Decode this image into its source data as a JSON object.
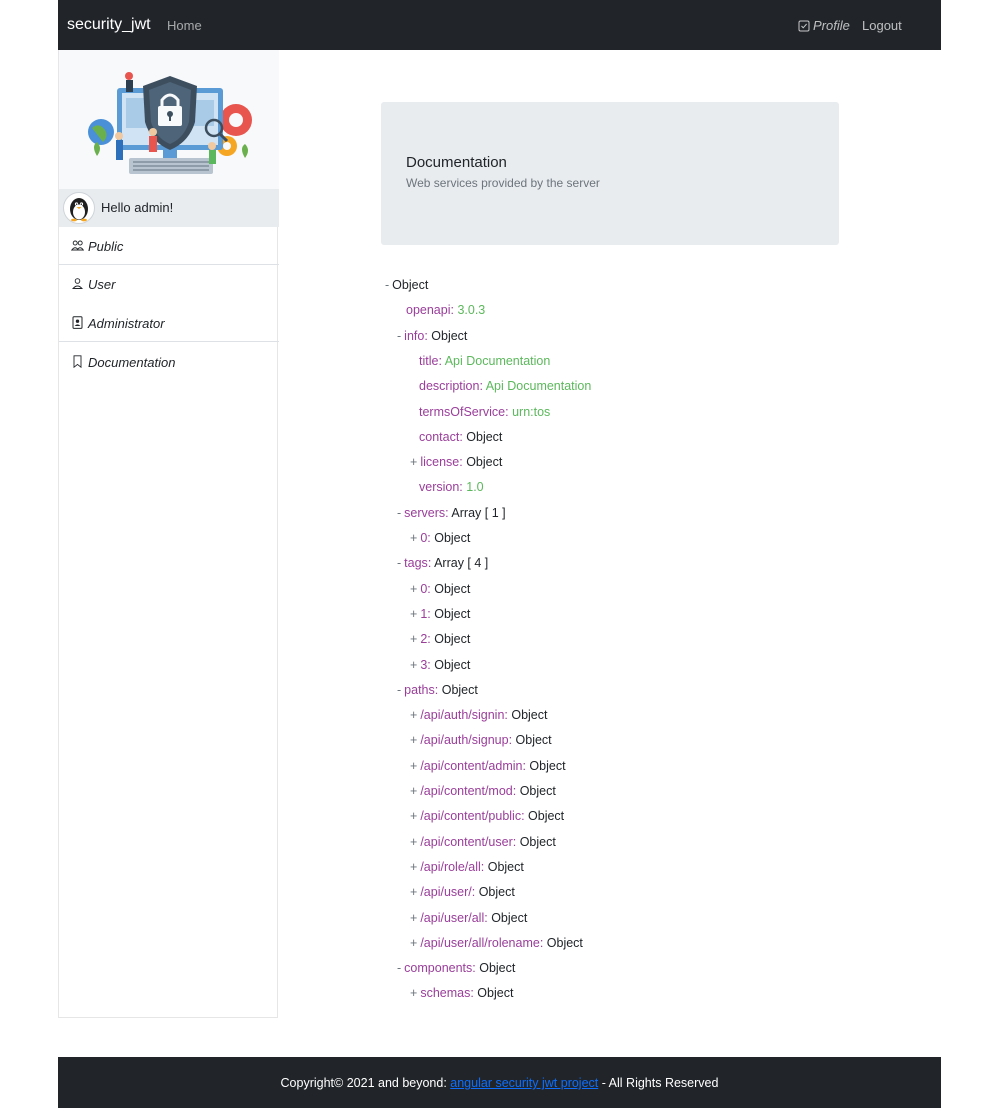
{
  "navbar": {
    "brand": "security_jwt",
    "home": "Home",
    "profile": "Profile",
    "logout": "Logout"
  },
  "sidebar": {
    "greeting": "Hello admin!",
    "items": [
      {
        "label": "Public",
        "icon": "people-icon"
      },
      {
        "label": "User",
        "icon": "person-icon"
      },
      {
        "label": "Administrator",
        "icon": "badge-icon"
      },
      {
        "label": "Documentation",
        "icon": "bookmark-icon"
      }
    ]
  },
  "jumbotron": {
    "title": "Documentation",
    "subtitle": "Web services provided by the server"
  },
  "tree": [
    {
      "toggle": "-",
      "key": "",
      "value": "Object",
      "kind": "type"
    },
    {
      "toggle": "",
      "key": "openapi",
      "value": "3.0.3",
      "kind": "val"
    },
    {
      "toggle": "-",
      "key": "info",
      "value": "Object",
      "kind": "type"
    },
    {
      "toggle": "",
      "key": "title",
      "value": "Api Documentation",
      "kind": "val"
    },
    {
      "toggle": "",
      "key": "description",
      "value": "Api Documentation",
      "kind": "val"
    },
    {
      "toggle": "",
      "key": "termsOfService",
      "value": "urn:tos",
      "kind": "val"
    },
    {
      "toggle": "",
      "key": "contact",
      "value": "Object",
      "kind": "type"
    },
    {
      "toggle": "+",
      "key": "license",
      "value": "Object",
      "kind": "type"
    },
    {
      "toggle": "",
      "key": "version",
      "value": "1.0",
      "kind": "val"
    },
    {
      "toggle": "-",
      "key": "servers",
      "value": "Array [ 1 ]",
      "kind": "type"
    },
    {
      "toggle": "+",
      "key": "0",
      "value": "Object",
      "kind": "type"
    },
    {
      "toggle": "-",
      "key": "tags",
      "value": "Array [ 4 ]",
      "kind": "type"
    },
    {
      "toggle": "+",
      "key": "0",
      "value": "Object",
      "kind": "type"
    },
    {
      "toggle": "+",
      "key": "1",
      "value": "Object",
      "kind": "type"
    },
    {
      "toggle": "+",
      "key": "2",
      "value": "Object",
      "kind": "type"
    },
    {
      "toggle": "+",
      "key": "3",
      "value": "Object",
      "kind": "type"
    },
    {
      "toggle": "-",
      "key": "paths",
      "value": "Object",
      "kind": "type"
    },
    {
      "toggle": "+",
      "key": "/api/auth/signin",
      "value": "Object",
      "kind": "type"
    },
    {
      "toggle": "+",
      "key": "/api/auth/signup",
      "value": "Object",
      "kind": "type"
    },
    {
      "toggle": "+",
      "key": "/api/content/admin",
      "value": "Object",
      "kind": "type"
    },
    {
      "toggle": "+",
      "key": "/api/content/mod",
      "value": "Object",
      "kind": "type"
    },
    {
      "toggle": "+",
      "key": "/api/content/public",
      "value": "Object",
      "kind": "type"
    },
    {
      "toggle": "+",
      "key": "/api/content/user",
      "value": "Object",
      "kind": "type"
    },
    {
      "toggle": "+",
      "key": "/api/role/all",
      "value": "Object",
      "kind": "type"
    },
    {
      "toggle": "+",
      "key": "/api/user/",
      "value": "Object",
      "kind": "type"
    },
    {
      "toggle": "+",
      "key": "/api/user/all",
      "value": "Object",
      "kind": "type"
    },
    {
      "toggle": "+",
      "key": "/api/user/all/rolename",
      "value": "Object",
      "kind": "type"
    },
    {
      "toggle": "-",
      "key": "components",
      "value": "Object",
      "kind": "type"
    },
    {
      "toggle": "+",
      "key": "schemas",
      "value": "Object",
      "kind": "type"
    }
  ],
  "footer": {
    "prefix": "Copyright© 2021 and beyond: ",
    "link": "angular security jwt project",
    "suffix": " - All Rights Reserved"
  },
  "colors": {
    "navbar_bg": "#212529",
    "key": "#9a3e9a",
    "value": "#5cb85c",
    "link": "#0d6efd"
  }
}
